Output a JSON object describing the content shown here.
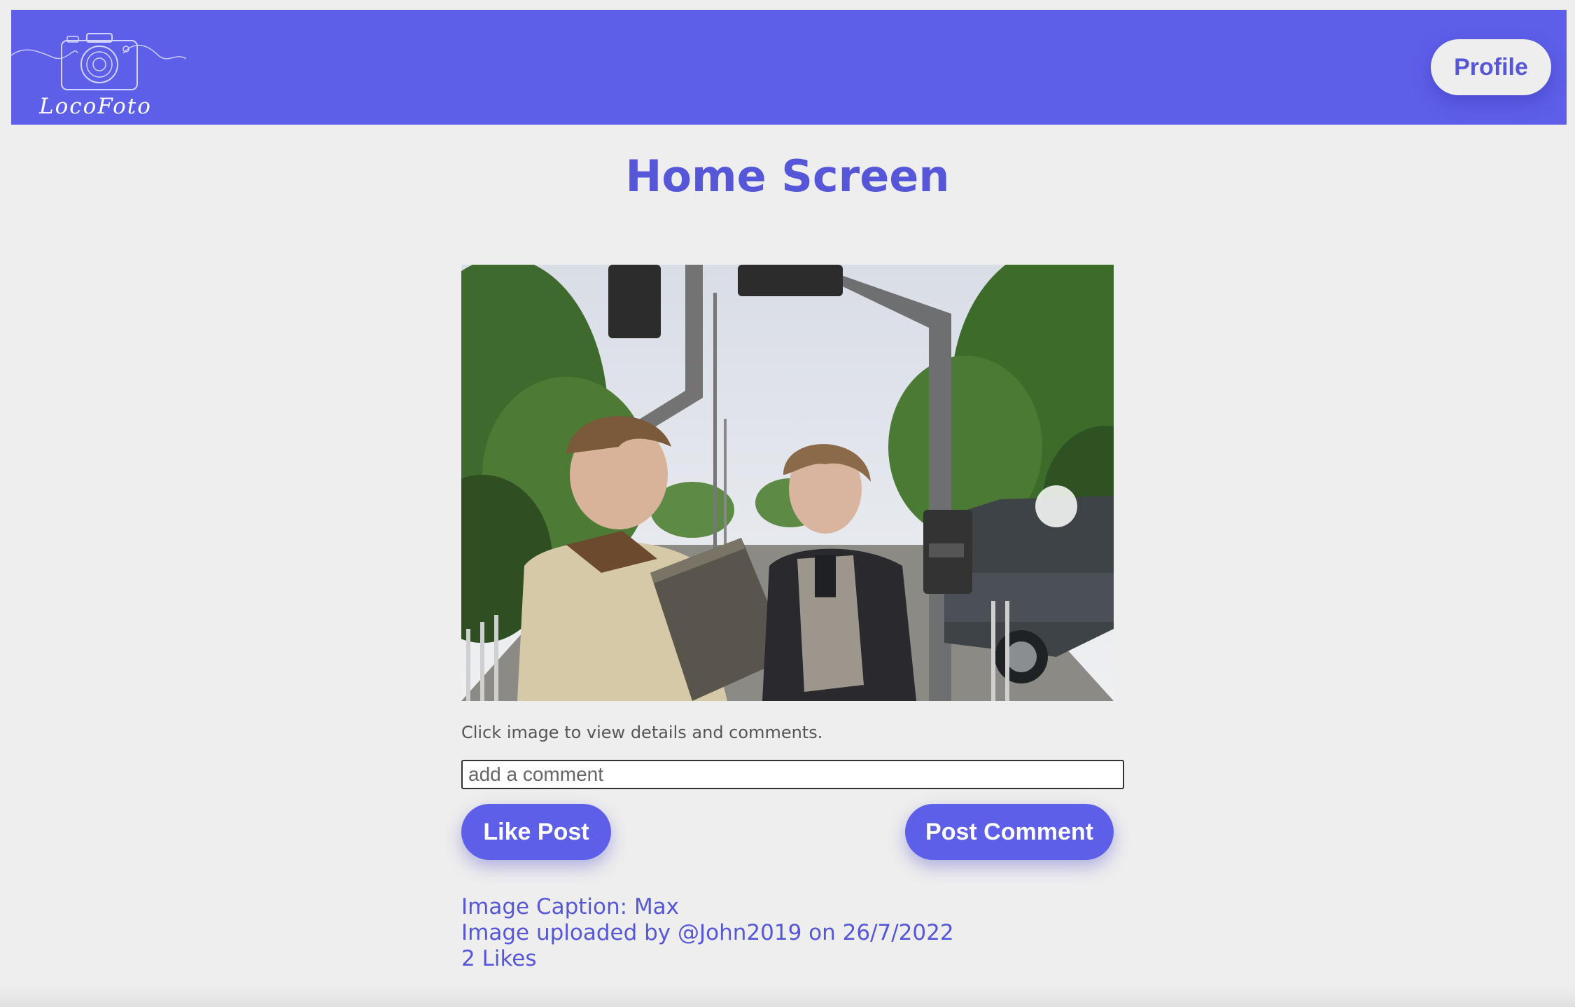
{
  "header": {
    "logo_text": "LocoFoto",
    "profile_label": "Profile"
  },
  "main": {
    "title": "Home Screen",
    "hint": "Click image to view details and comments.",
    "comment_placeholder": "add a comment",
    "like_label": "Like Post",
    "post_comment_label": "Post Comment"
  },
  "post": {
    "caption": "Image Caption: Max",
    "uploaded_by": "Image uploaded by @John2019 on 26/7/2022",
    "likes": "2 Likes"
  },
  "colors": {
    "accent": "#5e5fe8",
    "accent_text": "#5556d8",
    "background": "#eeeeee"
  },
  "icons": {
    "logo": "camera-icon"
  }
}
